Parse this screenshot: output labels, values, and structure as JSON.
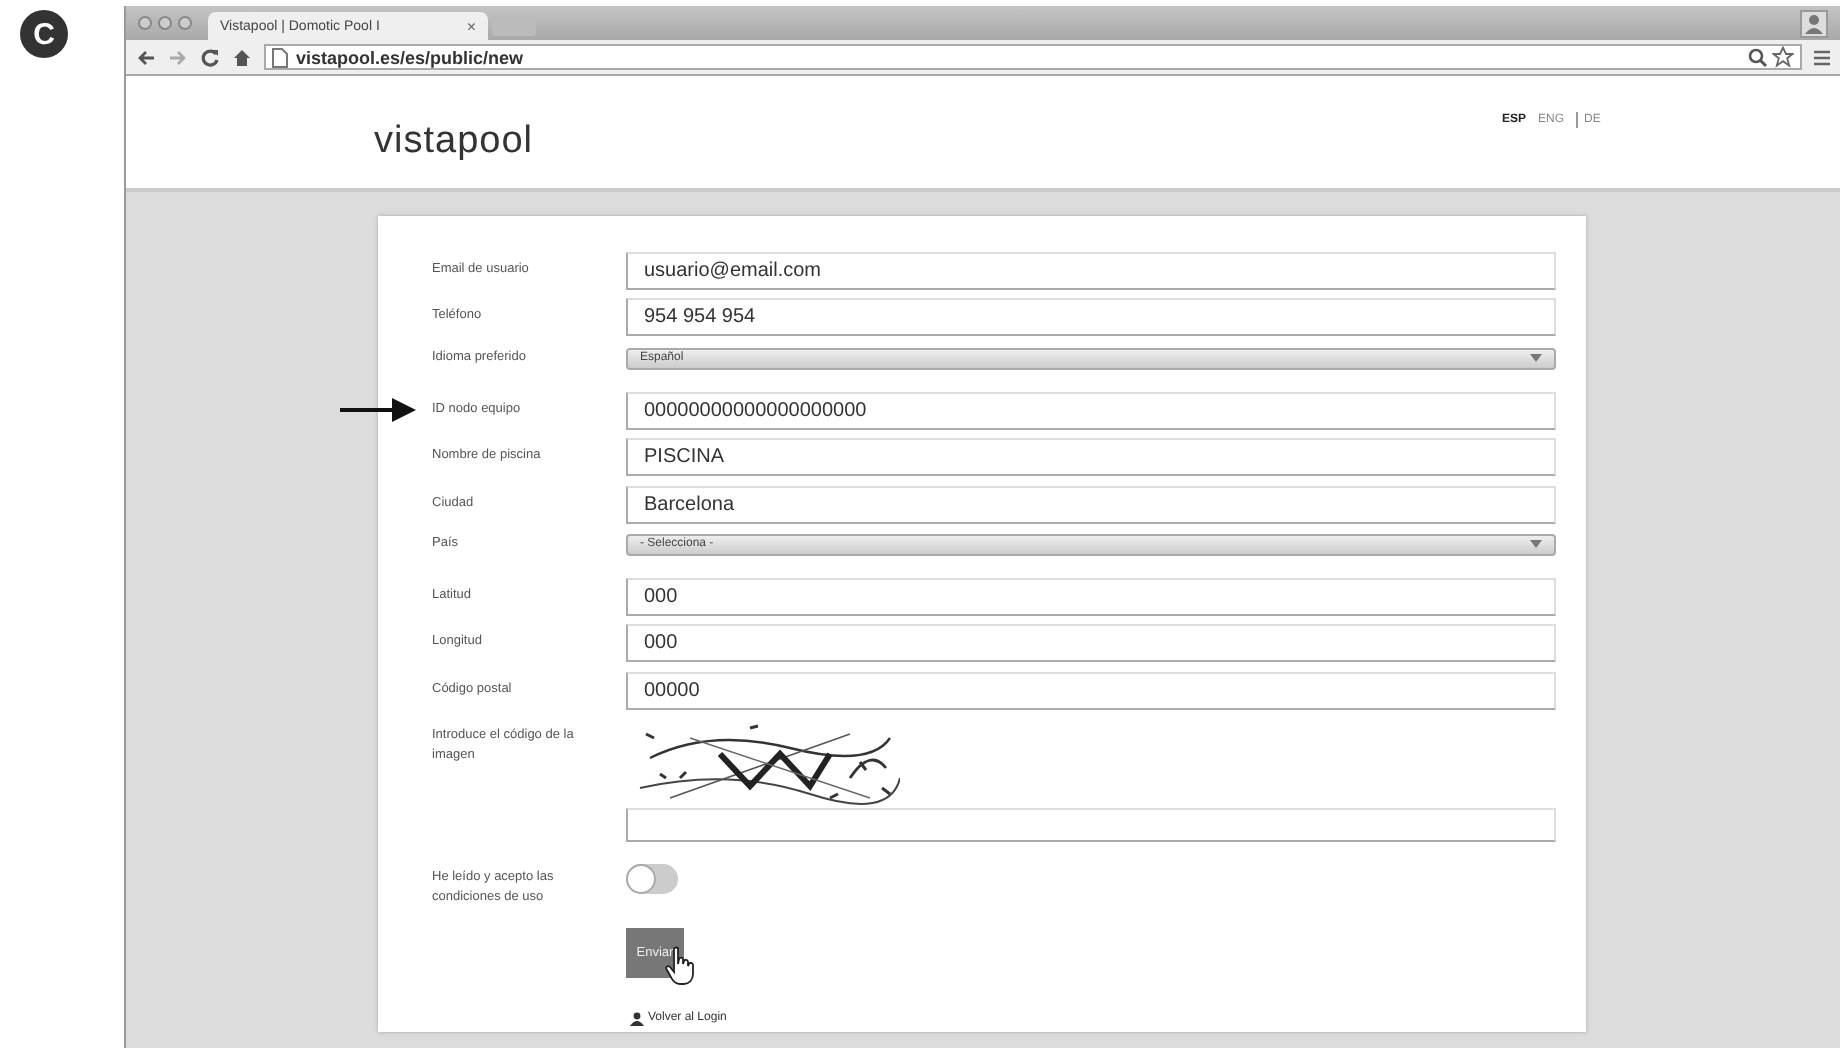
{
  "figure_label": "C",
  "browser": {
    "tab_title": "Vistapool | Domotic Pool I",
    "tab_close": "×",
    "url": "vistapool.es/es/public/new"
  },
  "header": {
    "logo": "vistapool",
    "languages": [
      {
        "label": "ESP",
        "selected": true
      },
      {
        "label": "ENG",
        "selected": false
      },
      {
        "label": "DE",
        "selected": false
      }
    ]
  },
  "form": {
    "fields": [
      {
        "kind": "input",
        "label": "Email de usuario",
        "value": "usuario@email.com",
        "pointed": false
      },
      {
        "kind": "input",
        "label": "Teléfono",
        "value": "954 954 954",
        "pointed": false
      },
      {
        "kind": "select",
        "label": "Idioma preferido",
        "value": "Español",
        "pointed": false
      },
      {
        "kind": "input",
        "label": "ID nodo equipo",
        "value": "00000000000000000000",
        "pointed": true
      },
      {
        "kind": "input",
        "label": "Nombre de piscina",
        "value": "PISCINA",
        "pointed": false
      },
      {
        "kind": "input",
        "label": "Ciudad",
        "value": "Barcelona",
        "pointed": false
      },
      {
        "kind": "select",
        "label": "País",
        "value": "- Selecciona -",
        "pointed": false
      },
      {
        "kind": "input",
        "label": "Latitud",
        "value": "000",
        "pointed": false
      },
      {
        "kind": "input",
        "label": "Longitud",
        "value": "000",
        "pointed": false
      },
      {
        "kind": "input",
        "label": "Código postal",
        "value": "00000",
        "pointed": false
      },
      {
        "kind": "captcha",
        "label": "Introduce el código de la imagen",
        "pointed": false
      },
      {
        "kind": "toggle",
        "label": "He leído y acepto las condiciones de uso",
        "on": false,
        "pointed": false
      }
    ],
    "submit": "Enviar",
    "back_link": "Volver al Login"
  }
}
